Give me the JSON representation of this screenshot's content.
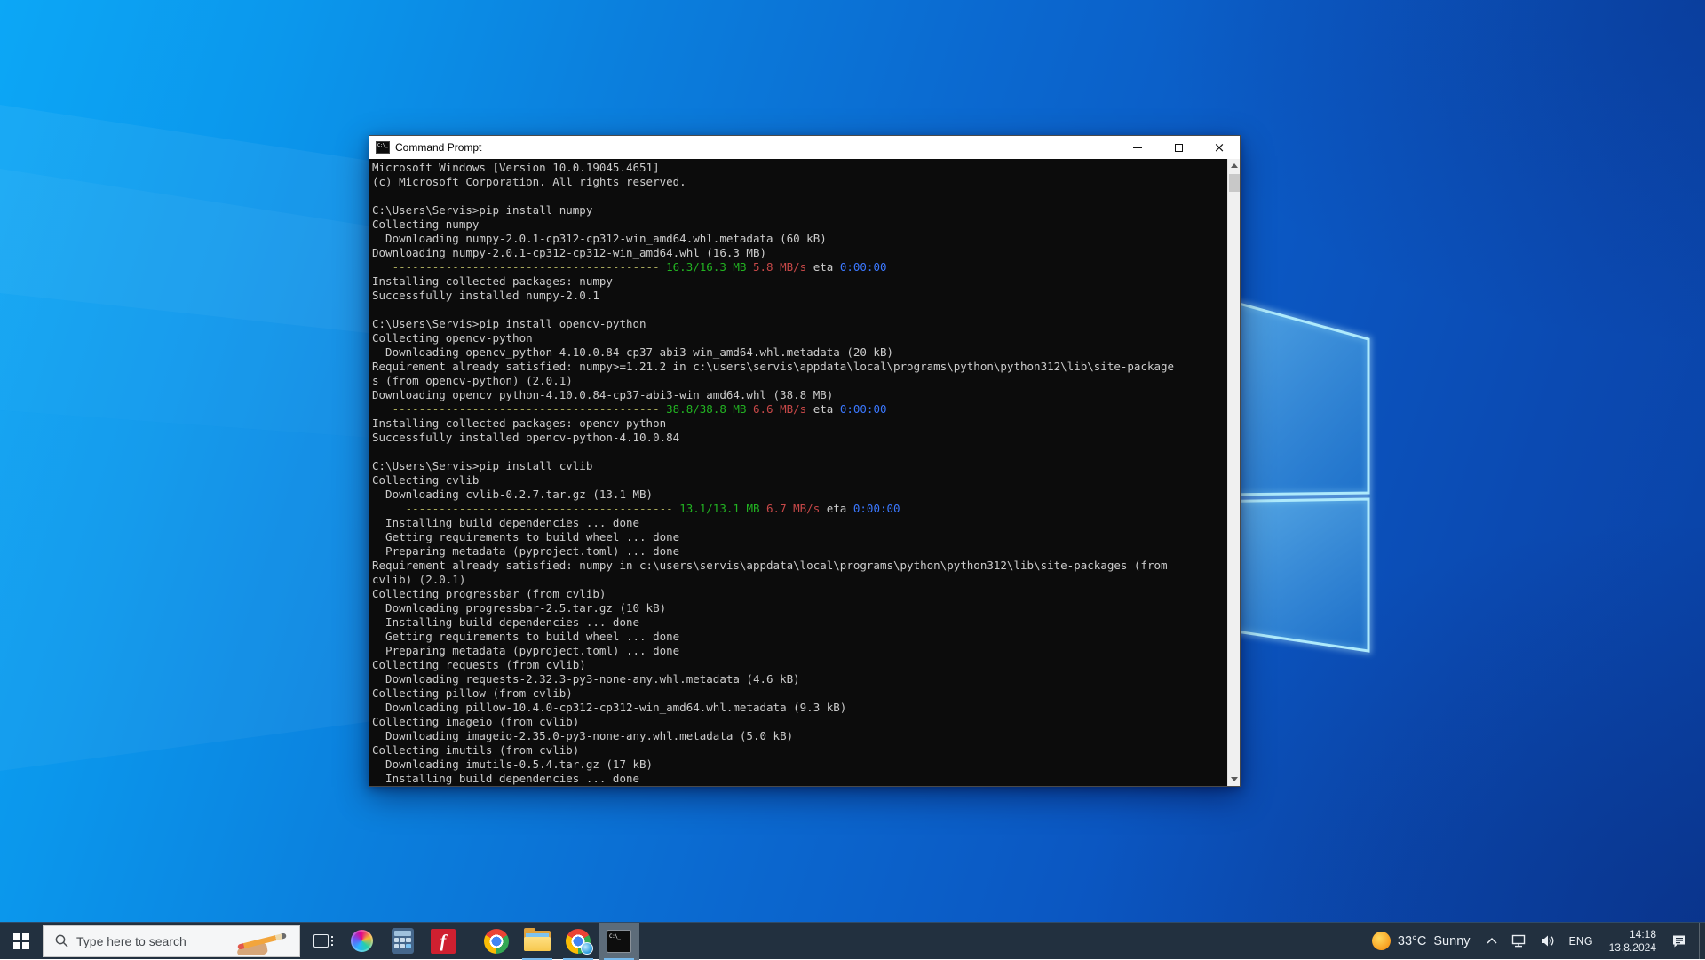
{
  "window": {
    "title": "Command Prompt",
    "controls": {
      "close": "×"
    }
  },
  "icons": {
    "cmd_glyph": "C:\\_",
    "titlebar_cmd_glyph": "C:\\_"
  },
  "terminal": {
    "lines": [
      "Microsoft Windows [Version 10.0.19045.4651]",
      "(c) Microsoft Corporation. All rights reserved.",
      "",
      "C:\\Users\\Servis>pip install numpy",
      "Collecting numpy",
      "  Downloading numpy-2.0.1-cp312-cp312-win_amd64.whl.metadata (60 kB)",
      "Downloading numpy-2.0.1-cp312-cp312-win_amd64.whl (16.3 MB)",
      [
        {
          "t": "   ----------------------------------------",
          "c": "bar"
        },
        {
          "t": " 16.3/16.3 MB",
          "c": "green"
        },
        {
          "t": " 5.8 MB/s",
          "c": "red"
        },
        {
          "t": " eta ",
          "c": "default"
        },
        {
          "t": "0:00:00",
          "c": "blue"
        }
      ],
      "Installing collected packages: numpy",
      "Successfully installed numpy-2.0.1",
      "",
      "C:\\Users\\Servis>pip install opencv-python",
      "Collecting opencv-python",
      "  Downloading opencv_python-4.10.0.84-cp37-abi3-win_amd64.whl.metadata (20 kB)",
      "Requirement already satisfied: numpy>=1.21.2 in c:\\users\\servis\\appdata\\local\\programs\\python\\python312\\lib\\site-package",
      "s (from opencv-python) (2.0.1)",
      "Downloading opencv_python-4.10.0.84-cp37-abi3-win_amd64.whl (38.8 MB)",
      [
        {
          "t": "   ----------------------------------------",
          "c": "bar"
        },
        {
          "t": " 38.8/38.8 MB",
          "c": "green"
        },
        {
          "t": " 6.6 MB/s",
          "c": "red"
        },
        {
          "t": " eta ",
          "c": "default"
        },
        {
          "t": "0:00:00",
          "c": "blue"
        }
      ],
      "Installing collected packages: opencv-python",
      "Successfully installed opencv-python-4.10.0.84",
      "",
      "C:\\Users\\Servis>pip install cvlib",
      "Collecting cvlib",
      "  Downloading cvlib-0.2.7.tar.gz (13.1 MB)",
      [
        {
          "t": "     ----------------------------------------",
          "c": "bar"
        },
        {
          "t": " 13.1/13.1 MB",
          "c": "green"
        },
        {
          "t": " 6.7 MB/s",
          "c": "red"
        },
        {
          "t": " eta ",
          "c": "default"
        },
        {
          "t": "0:00:00",
          "c": "blue"
        }
      ],
      "  Installing build dependencies ... done",
      "  Getting requirements to build wheel ... done",
      "  Preparing metadata (pyproject.toml) ... done",
      "Requirement already satisfied: numpy in c:\\users\\servis\\appdata\\local\\programs\\python\\python312\\lib\\site-packages (from",
      "cvlib) (2.0.1)",
      "Collecting progressbar (from cvlib)",
      "  Downloading progressbar-2.5.tar.gz (10 kB)",
      "  Installing build dependencies ... done",
      "  Getting requirements to build wheel ... done",
      "  Preparing metadata (pyproject.toml) ... done",
      "Collecting requests (from cvlib)",
      "  Downloading requests-2.32.3-py3-none-any.whl.metadata (4.6 kB)",
      "Collecting pillow (from cvlib)",
      "  Downloading pillow-10.4.0-cp312-cp312-win_amd64.whl.metadata (9.3 kB)",
      "Collecting imageio (from cvlib)",
      "  Downloading imageio-2.35.0-py3-none-any.whl.metadata (5.0 kB)",
      "Collecting imutils (from cvlib)",
      "  Downloading imutils-0.5.4.tar.gz (17 kB)",
      "  Installing build dependencies ... done"
    ]
  },
  "taskbar": {
    "search": {
      "placeholder": "Type here to search"
    },
    "f_app_label": "f",
    "tray": {
      "weather_temp": "33°C",
      "weather_cond": "Sunny",
      "language": "ENG",
      "time": "14:18",
      "date": "13.8.2024"
    }
  },
  "colors": {
    "taskbar_bg": "#22303f",
    "terminal_bg": "#0c0c0c",
    "progress_bar": "#a9a95c",
    "progress_done": "#22b322",
    "speed_red": "#c74848",
    "eta_blue": "#3b78ff",
    "running_underline": "#76b9ed"
  }
}
